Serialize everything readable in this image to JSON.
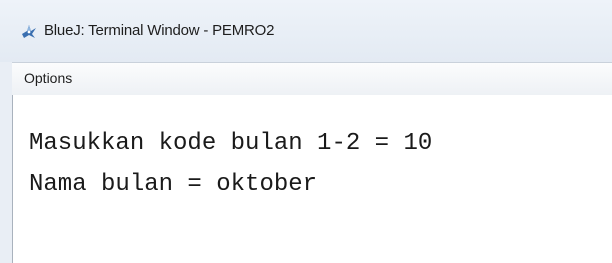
{
  "window": {
    "title": "BlueJ: Terminal Window - PEMRO2",
    "icon": "bluej-bird-icon"
  },
  "menubar": {
    "options_label": "Options"
  },
  "terminal": {
    "lines": [
      "Masukkan kode bulan 1-2 = 10",
      "Nama bulan = oktober"
    ]
  }
}
